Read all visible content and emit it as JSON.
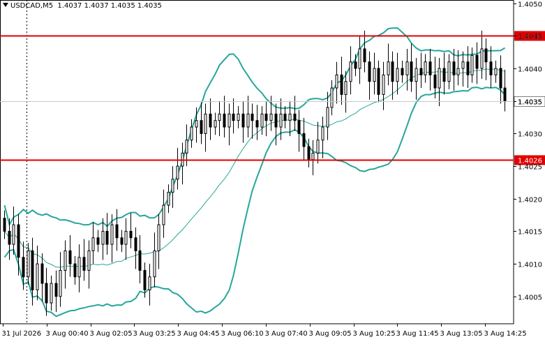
{
  "header": {
    "symbol_tf": "USDCAD,M5",
    "ohlc": "1.4037 1.4037 1.4035 1.4035"
  },
  "colors": {
    "background": "#ffffff",
    "candle": "#000000",
    "bands": "#26a69a",
    "level": "#e00000",
    "grid": "#c8c8c8"
  },
  "chart_data": {
    "type": "candlestick",
    "symbol": "USDCAD",
    "timeframe": "M5",
    "ylim": [
      1.40008,
      1.40505
    ],
    "yticks": [
      "1.4050",
      "1.4045",
      "1.4040",
      "1.4035",
      "1.4030",
      "1.4025",
      "1.4020",
      "1.4015",
      "1.4010",
      "1.4005"
    ],
    "xticks": [
      "31 Jul 2026",
      "3 Aug 00:40",
      "3 Aug 02:05",
      "3 Aug 03:25",
      "3 Aug 04:45",
      "3 Aug 06:10",
      "3 Aug 07:40",
      "3 Aug 09:05",
      "3 Aug 10:25",
      "3 Aug 11:45",
      "3 Aug 13:05",
      "3 Aug 14:25"
    ],
    "levels": [
      {
        "price": 1.4045,
        "label": "1.4045"
      },
      {
        "price": 1.4026,
        "label": "1.4026"
      }
    ],
    "current_price": {
      "price": 1.4035,
      "label": "1.4035"
    },
    "period_separator": "3 Aug 00:00",
    "indicator": "Bollinger Bands",
    "closes": [
      1.4015,
      1.4013,
      1.4016,
      1.4011,
      1.4008,
      1.4012,
      1.4006,
      1.401,
      1.4007,
      1.4004,
      1.4007,
      1.4005,
      1.4009,
      1.4012,
      1.401,
      1.4008,
      1.4011,
      1.4009,
      1.4012,
      1.4014,
      1.4013,
      1.4015,
      1.4013,
      1.4016,
      1.4014,
      1.4013,
      1.4015,
      1.4014,
      1.4012,
      1.4009,
      1.4006,
      1.4008,
      1.4012,
      1.4016,
      1.4019,
      1.4021,
      1.4023,
      1.4025,
      1.4027,
      1.4029,
      1.4031,
      1.4032,
      1.403,
      1.4033,
      1.4031,
      1.4032,
      1.4033,
      1.4031,
      1.4033,
      1.4032,
      1.4033,
      1.4031,
      1.4033,
      1.4032,
      1.4031,
      1.4033,
      1.4032,
      1.4033,
      1.4031,
      1.4033,
      1.4032,
      1.4033,
      1.4032,
      1.403,
      1.4028,
      1.4026,
      1.4027,
      1.4029,
      1.4031,
      1.4034,
      1.4037,
      1.4039,
      1.4036,
      1.4038,
      1.4041,
      1.404,
      1.4043,
      1.4041,
      1.4038,
      1.404,
      1.4036,
      1.4039,
      1.4041,
      1.4038,
      1.404,
      1.4039,
      1.4041,
      1.4038,
      1.404,
      1.4039,
      1.4041,
      1.4039,
      1.4037,
      1.404,
      1.4038,
      1.4041,
      1.4039,
      1.404,
      1.4041,
      1.4039,
      1.4042,
      1.404,
      1.4043,
      1.4041,
      1.4039,
      1.404,
      1.4037,
      1.4035
    ]
  }
}
